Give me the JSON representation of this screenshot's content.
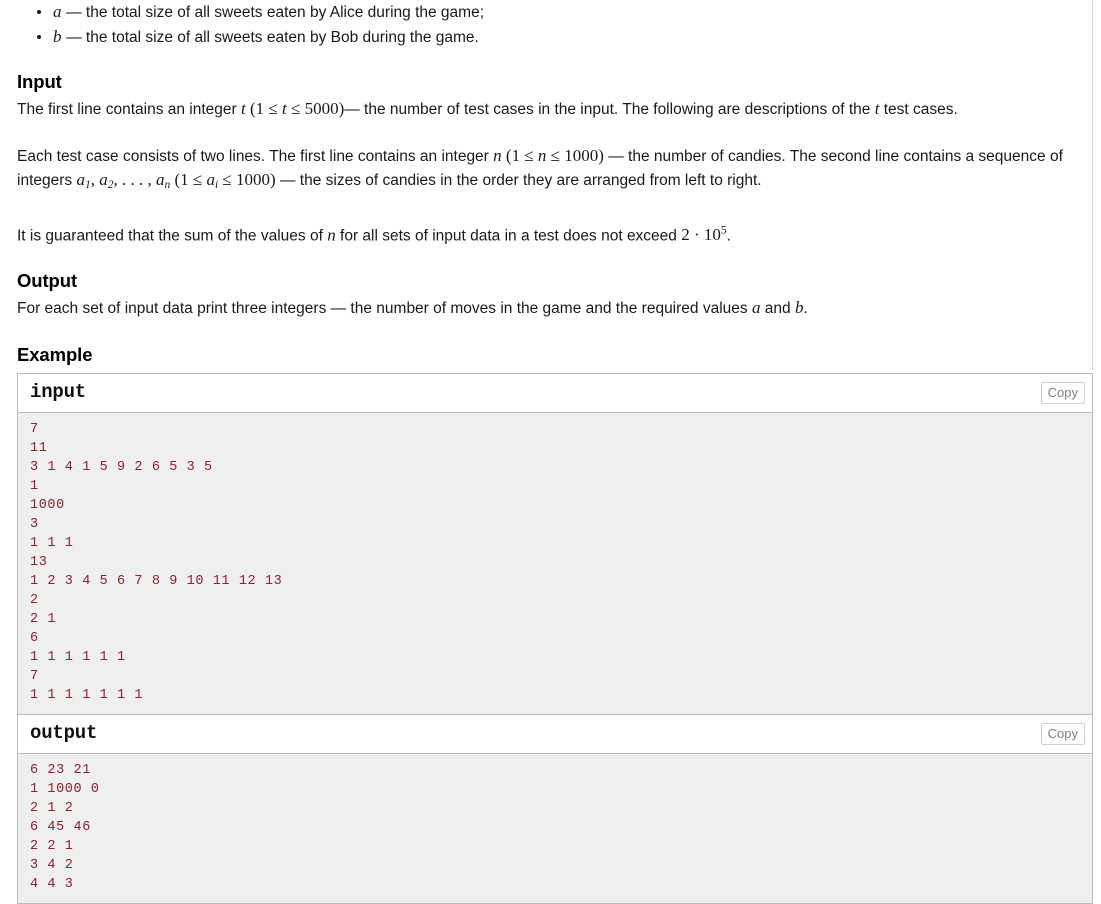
{
  "problem": {
    "bullets": [
      {
        "symbol": "a",
        "text": "— the total size of all sweets eaten by Alice during the game;"
      },
      {
        "symbol": "b",
        "text": "— the total size of all sweets eaten by Bob during the game."
      }
    ],
    "input_section": {
      "heading": "Input",
      "paragraph1_before": "The first line contains an integer",
      "paragraph1_math": "t (1 ≤ t ≤ 5000)",
      "paragraph1_after": "— the number of test cases in the input. The following are descriptions of the",
      "paragraph1_math2": "t",
      "paragraph1_end": "test cases.",
      "paragraph2_before": "Each test case consists of two lines. The first line contains an integer",
      "paragraph2_math": "n (1 ≤ n ≤ 1000)",
      "paragraph2_mid": "— the number of candies. The second line contains a sequence of integers",
      "paragraph2_math2": "a1, a2, . . . , an (1 ≤ ai ≤ 1000)",
      "paragraph2_after": "— the sizes of candies in the order they are arranged from left to right.",
      "paragraph3_before": "It is guaranteed that the sum of the values of",
      "paragraph3_math": "n",
      "paragraph3_mid": "for all sets of input data in a test does not exceed",
      "paragraph3_math2": "2 · 10^5",
      "paragraph3_end": "."
    },
    "output_section": {
      "heading": "Output",
      "paragraph_before": "For each set of input data print three integers — the number of moves in the game and the required values",
      "math_a": "a",
      "conjunction": "and",
      "math_b": "b",
      "period": "."
    },
    "example_section": {
      "heading": "Example",
      "input_label": "input",
      "output_label": "output",
      "copy_label": "Copy",
      "input_data": "7\n11\n3 1 4 1 5 9 2 6 5 3 5\n1\n1000\n3\n1 1 1\n13\n1 2 3 4 5 6 7 8 9 10 11 12 13\n2\n2 1\n6\n1 1 1 1 1 1\n7\n1 1 1 1 1 1 1",
      "output_data": "6 23 21\n1 1000 0\n2 1 2\n6 45 46\n2 2 1\n3 4 2\n4 4 3"
    }
  },
  "colors": {
    "data_text": "#8d2130",
    "data_background": "#efefef",
    "panel_border": "#bdbdbd",
    "copy_text": "#808080"
  }
}
